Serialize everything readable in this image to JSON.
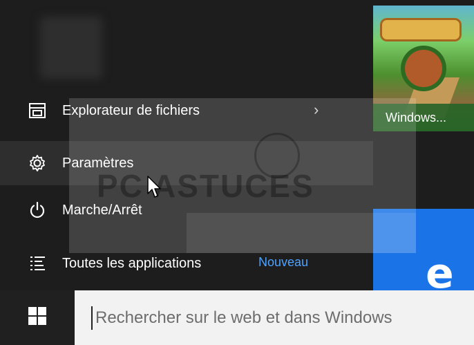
{
  "menu": {
    "items": [
      {
        "label": "Explorateur de fichiers",
        "icon": "file-explorer-icon"
      },
      {
        "label": "Paramètres",
        "icon": "gear-icon"
      },
      {
        "label": "Marche/Arrêt",
        "icon": "power-icon"
      },
      {
        "label": "Toutes les applications",
        "icon": "list-icon"
      }
    ],
    "new_badge": "Nouveau",
    "chevron": "›"
  },
  "tiles": {
    "game": {
      "label": "Windows...",
      "color": "#2a6e2a"
    },
    "edge": {
      "logo": "e",
      "color": "#1a74e8"
    }
  },
  "watermark": {
    "text": "PC ASTUCES"
  },
  "taskbar": {
    "search": {
      "placeholder": "Rechercher sur le web et dans Windows"
    }
  }
}
